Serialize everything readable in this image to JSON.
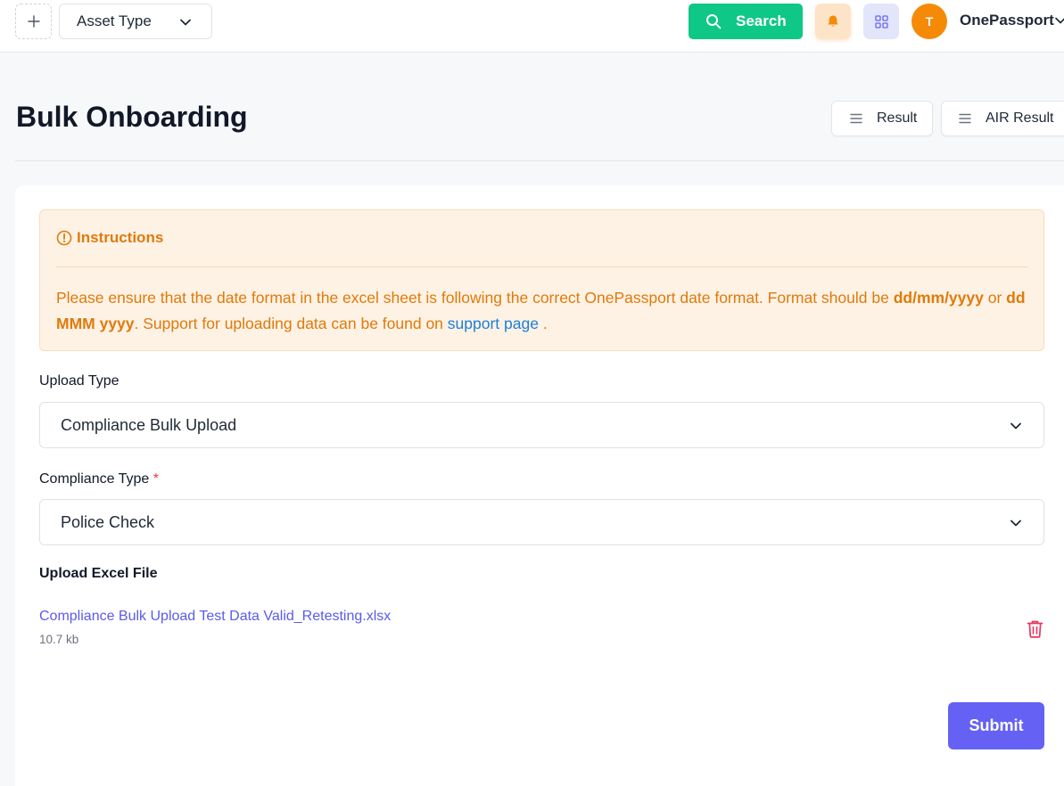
{
  "topbar": {
    "add_icon": "plus-icon",
    "asset_type": "Asset Type",
    "search_label": "Search",
    "bell_icon": "bell-icon",
    "apps_icon": "grid-icon",
    "avatar_initial": "T",
    "org_name": "OnePassport",
    "colors": {
      "search": "#0fc786",
      "avatar": "#f58a07"
    }
  },
  "header": {
    "title": "Bulk Onboarding",
    "result_label": "Result",
    "air_result_label": "AIR Result"
  },
  "instructions": {
    "title": "Instructions",
    "text_1": "Please ensure that the date format in the excel sheet is following the correct OnePassport date format. Format should be ",
    "format_1": "dd/mm/yyyy",
    "text_or": " or ",
    "format_2": "dd MMM yyyy",
    "text_2": ". Support for uploading data can be found on ",
    "link": "support page",
    "text_end": " ."
  },
  "form": {
    "upload_type_label": "Upload Type",
    "upload_type_value": "Compliance Bulk Upload",
    "compliance_type_label": "Compliance Type",
    "required_mark": "*",
    "compliance_type_value": "Police Check",
    "upload_file_label": "Upload Excel File",
    "file_name": "Compliance Bulk Upload Test Data Valid_Retesting.xlsx",
    "file_size": "10.7 kb",
    "submit_label": "Submit",
    "colors": {
      "submit": "#6461f4",
      "file_link": "#5b5bea"
    }
  }
}
